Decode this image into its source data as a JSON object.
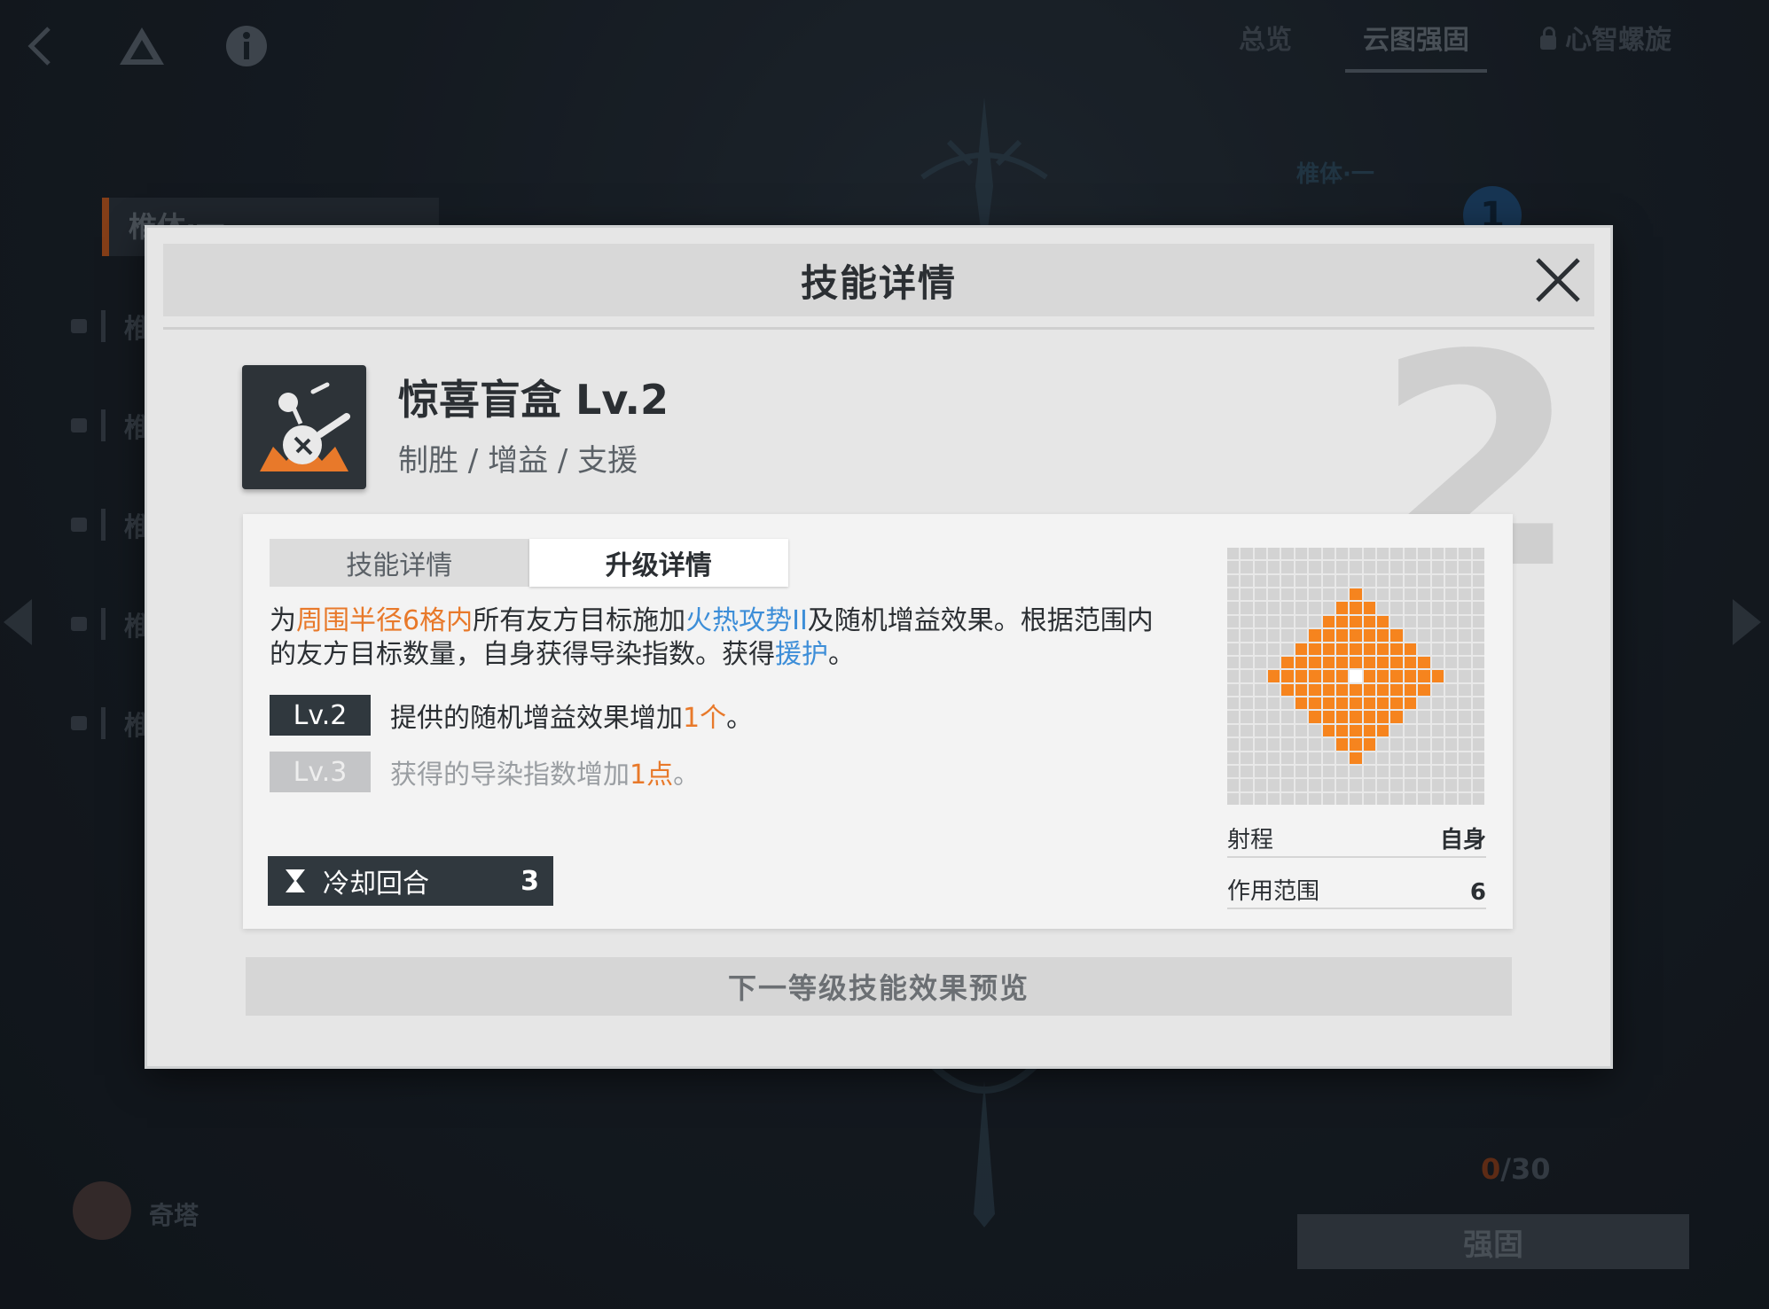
{
  "top_tabs": [
    {
      "label": "总览"
    },
    {
      "label": "云图强固"
    },
    {
      "label": "心智螺旋",
      "locked": true
    }
  ],
  "background": {
    "side_active_label": "椎体·一",
    "side_locked_label": "椎",
    "right_label": "椎体·一",
    "node_number": "1",
    "counter_current": "0",
    "counter_total": "/30",
    "strengthen_label": "强固",
    "character_name": "奇塔"
  },
  "modal": {
    "title": "技能详情",
    "big_level": "2",
    "skill": {
      "name": "惊喜盲盒 Lv.2",
      "tags": "制胜 / 增益 / 支援",
      "icon": "mystery-box-icon"
    },
    "segments": [
      "技能详情",
      "升级详情"
    ],
    "active_segment": 1,
    "description": {
      "p1": "为",
      "h1": "周围半径6格内",
      "p2": "所有友方目标施加",
      "h2": "火热攻势II",
      "p3": "及随机增益效果。根据范围内的友方目标数量，自身获得导染指数。获得",
      "h3": "援护",
      "p4": "。"
    },
    "levels": [
      {
        "badge": "Lv.2",
        "text": "提供的随机增益效果增加",
        "highlight": "1个",
        "suffix": "。",
        "state": "current"
      },
      {
        "badge": "Lv.3",
        "text": "获得的导染指数增加",
        "highlight": "1点",
        "suffix": "。",
        "state": "locked"
      }
    ],
    "cooldown": {
      "label": "冷却回合",
      "value": "3"
    },
    "range_grid": {
      "size": 19,
      "radius": 6
    },
    "stats": [
      {
        "label": "射程",
        "value": "自身"
      },
      {
        "label": "作用范围",
        "value": "6"
      }
    ],
    "preview_button": "下一等级技能效果预览"
  },
  "colors": {
    "accent_orange": "#f6841e",
    "highlight_orange": "#e8792a",
    "highlight_blue": "#3d8ed8",
    "dark_badge": "#30383e"
  }
}
